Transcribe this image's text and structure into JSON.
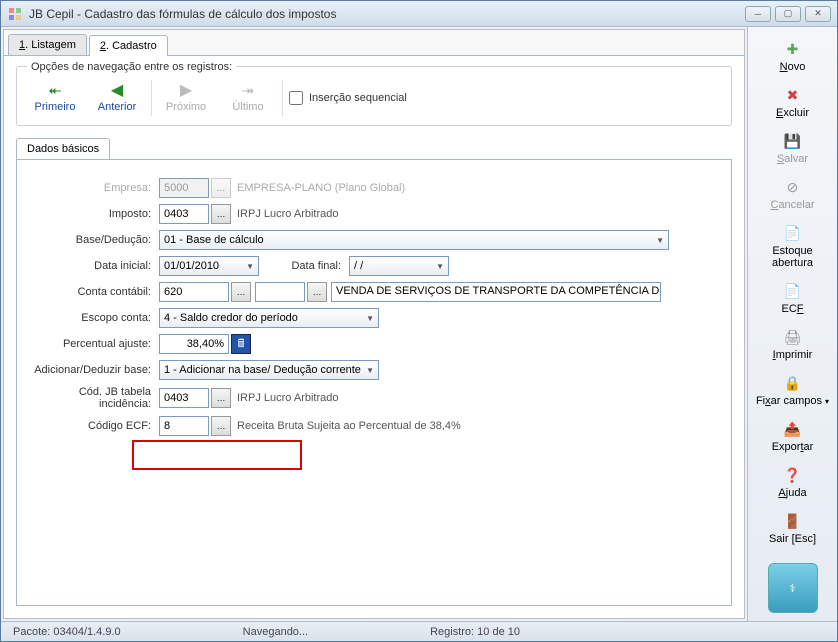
{
  "titlebar": {
    "title": "JB Cepil - Cadastro das fórmulas de cálculo dos impostos"
  },
  "tabs": {
    "listagem": "1. Listagem",
    "cadastro": "2. Cadastro"
  },
  "nav": {
    "legend": "Opções de navegação entre os registros:",
    "primeiro": "Primeiro",
    "anterior": "Anterior",
    "proximo": "Próximo",
    "ultimo": "Último",
    "insercao_label": "Inserção sequencial"
  },
  "inner_tab": "Dados básicos",
  "form": {
    "empresa_label": "Empresa:",
    "empresa_value": "5000",
    "empresa_desc": "EMPRESA-PLANO (Plano Global)",
    "imposto_label": "Imposto:",
    "imposto_value": "0403",
    "imposto_desc": "IRPJ Lucro Arbitrado",
    "base_label": "Base/Dedução:",
    "base_value": "01 - Base de cálculo",
    "data_inicial_label": "Data inicial:",
    "data_inicial_value": "01/01/2010",
    "data_final_label": "Data final:",
    "data_final_value": "/  /",
    "conta_label": "Conta contábil:",
    "conta_value": "620",
    "conta_desc": "VENDA DE SERVIÇOS DE TRANSPORTE DA COMPETÊNCIA DO I",
    "escopo_label": "Escopo conta:",
    "escopo_value": "4 - Saldo credor do período",
    "percentual_label": "Percentual ajuste:",
    "percentual_value": "38,40%",
    "add_ded_label": "Adicionar/Deduzir base:",
    "add_ded_value": "1 - Adicionar na base/ Dedução corrente",
    "cod_jb_label": "Cód. JB tabela incidência:",
    "cod_jb_value": "0403",
    "cod_jb_desc": "IRPJ Lucro Arbitrado",
    "ecf_label": "Código ECF:",
    "ecf_value": "8",
    "ecf_desc": "Receita Bruta Sujeita ao Percentual de 38,4%"
  },
  "sidebar": {
    "novo": "Novo",
    "excluir": "Excluir",
    "salvar": "Salvar",
    "cancelar": "Cancelar",
    "estoque": "Estoque abertura",
    "ecf": "ECF",
    "imprimir": "Imprimir",
    "fixar": "Fixar campos",
    "exportar": "Exportar",
    "ajuda": "Ajuda",
    "sair": "Sair [Esc]"
  },
  "statusbar": {
    "pacote": "Pacote: 03404/1.4.9.0",
    "status": "Navegando...",
    "registro": "Registro: 10 de 10"
  }
}
